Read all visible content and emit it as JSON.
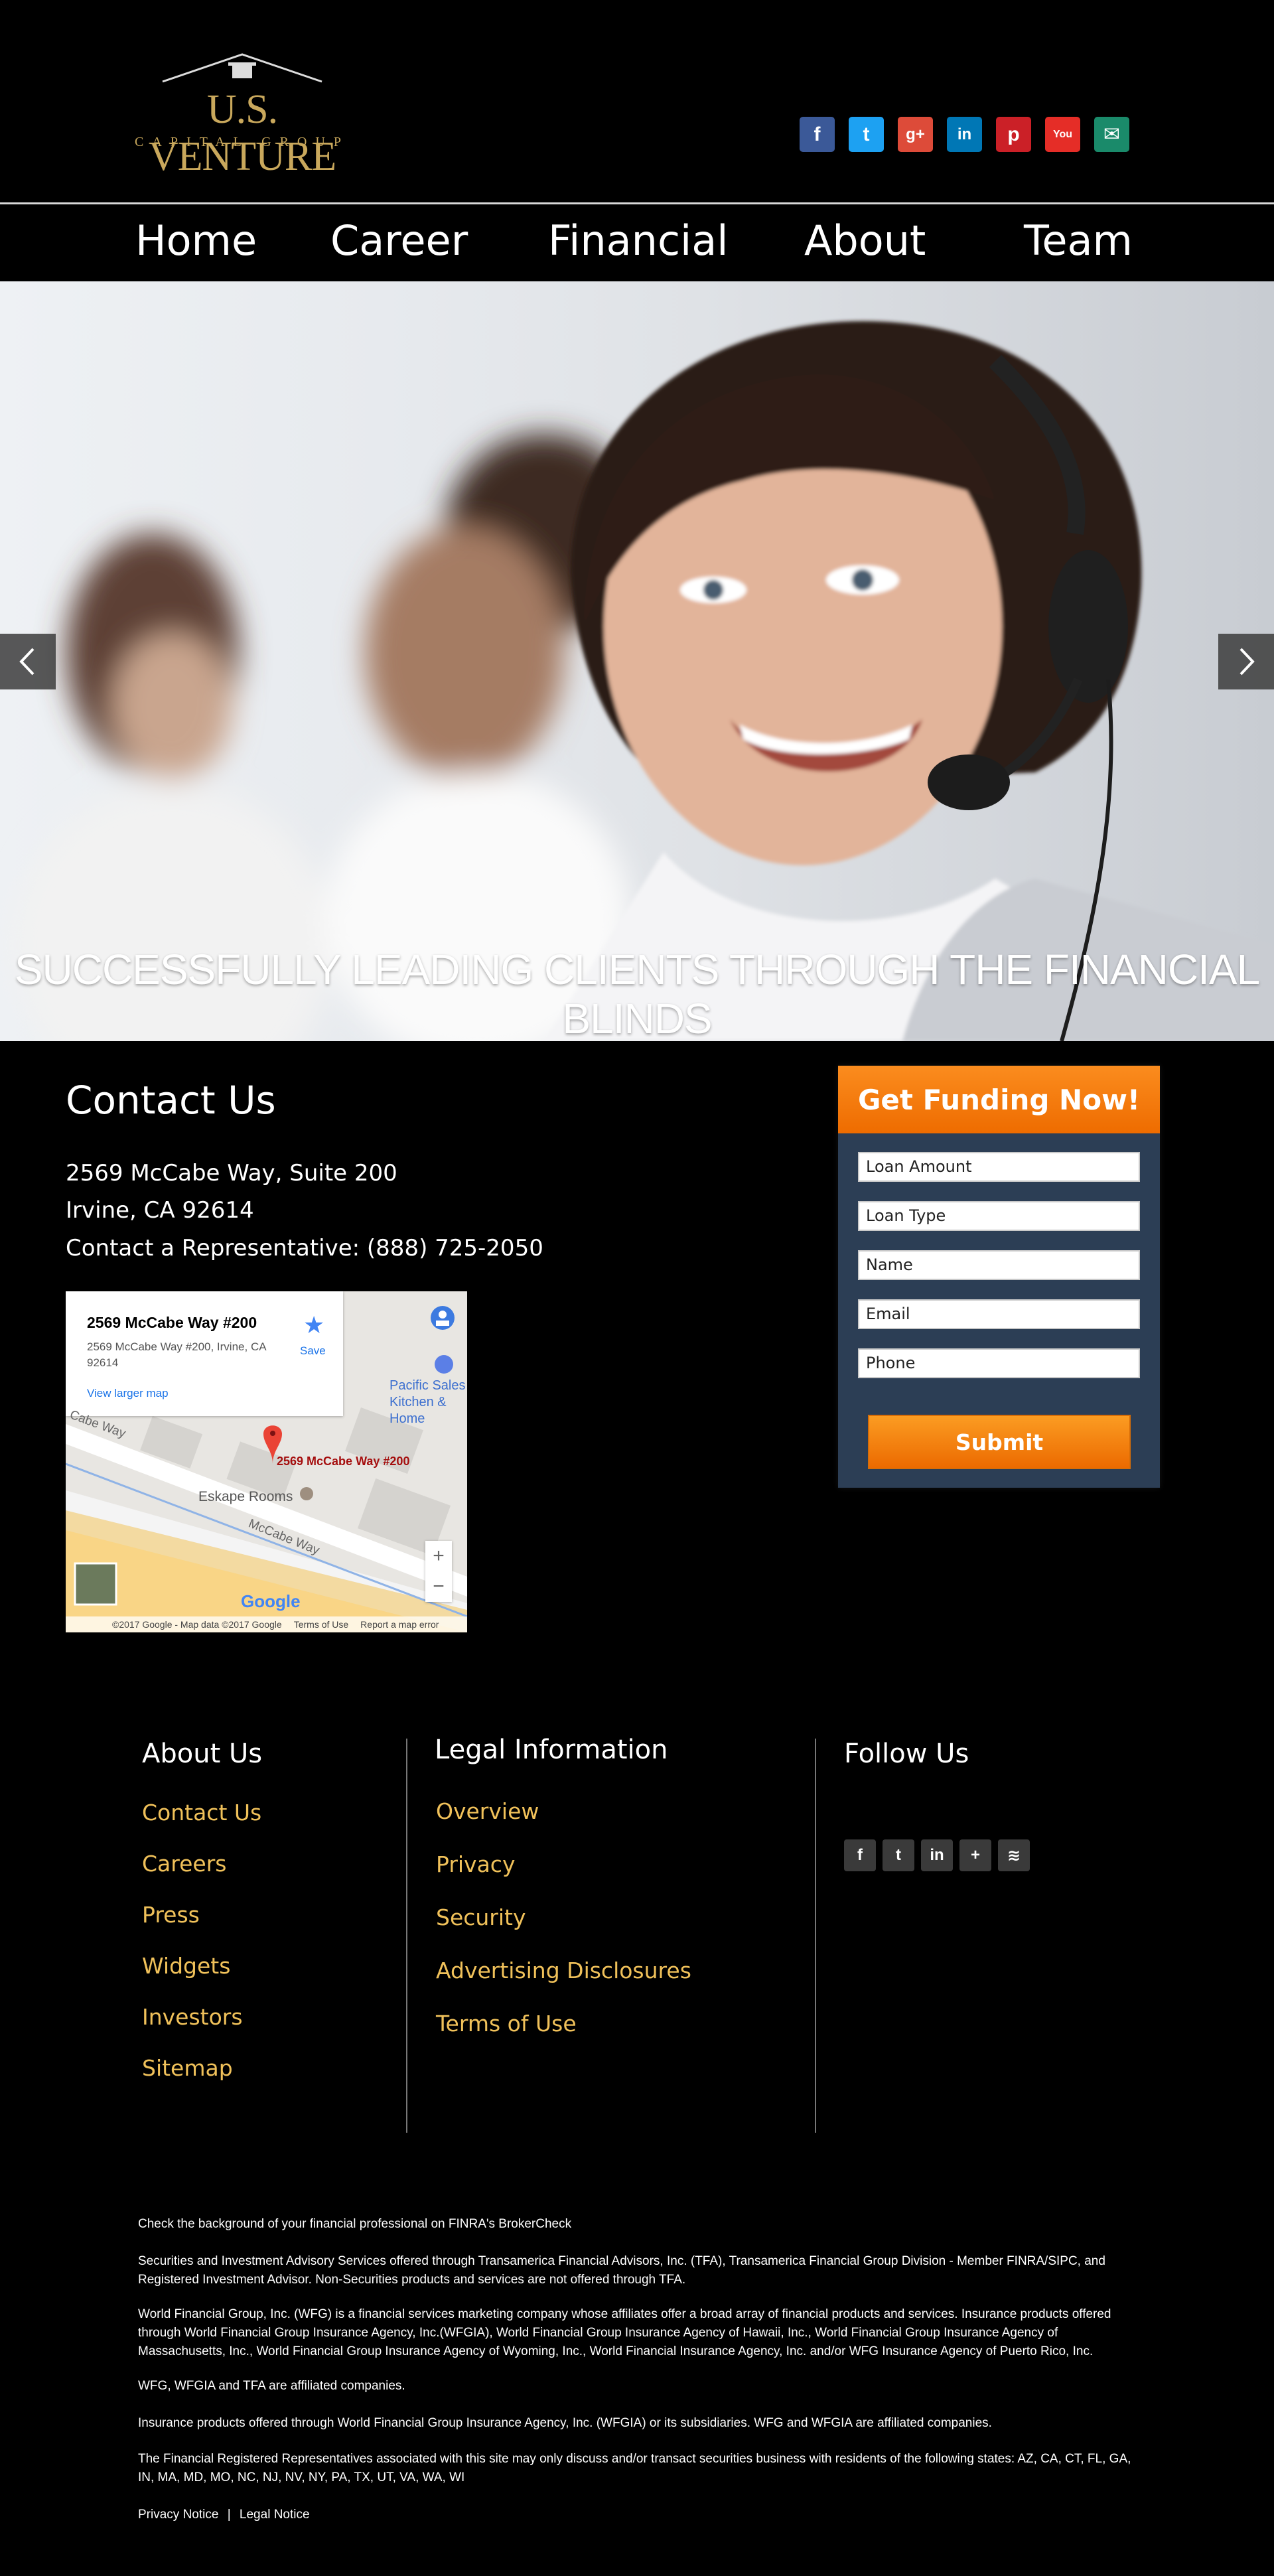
{
  "brand": {
    "name": "U.S. VENTURE",
    "sub": "CAPITAL GROUP",
    "gold": "#c9a85c"
  },
  "social_top": [
    {
      "name": "facebook-icon",
      "glyph": "f",
      "color": "#3b5998"
    },
    {
      "name": "twitter-icon",
      "glyph": "t",
      "color": "#1da1f2"
    },
    {
      "name": "google-plus-icon",
      "glyph": "g+",
      "color": "#dd4b39"
    },
    {
      "name": "linkedin-icon",
      "glyph": "in",
      "color": "#0077b5"
    },
    {
      "name": "pinterest-icon",
      "glyph": "p",
      "color": "#cb2027"
    },
    {
      "name": "youtube-icon",
      "glyph": "You",
      "color": "#e52d27"
    },
    {
      "name": "mail-icon",
      "glyph": "✉",
      "color": "#1a8a6a"
    }
  ],
  "nav": [
    "Home",
    "Career",
    "Financial",
    "About",
    "Team"
  ],
  "hero": {
    "caption": "SUCCESSFULLY LEADING CLIENTS THROUGH THE FINANCIAL BLINDS"
  },
  "contact": {
    "title": "Contact Us",
    "line1": "2569 McCabe Way, Suite 200",
    "line2": "Irvine, CA 92614",
    "line3": "Contact a Representative: (888) 725-2050"
  },
  "map": {
    "place_title": "2569 McCabe Way #200",
    "place_address": "2569 McCabe Way #200, Irvine, CA 92614",
    "view_larger": "View larger map",
    "save": "Save",
    "pin_label": "2569 McCabe Way #200",
    "eskape": "Eskape Rooms",
    "pacific": "Pacific Sales Kitchen & Home",
    "road1": "McCabe Way",
    "road2": "Cabe Way",
    "zoom_in": "+",
    "zoom_out": "−",
    "google": "Google",
    "attribution": "©2017 Google - Map data ©2017 Google",
    "terms": "Terms of Use",
    "report": "Report a map error"
  },
  "form": {
    "title": "Get Funding Now!",
    "fields": [
      "Loan Amount",
      "Loan Type",
      "Name",
      "Email",
      "Phone"
    ],
    "submit": "Submit",
    "accent": "#f7850f",
    "panel": "#2c3e55"
  },
  "footer": {
    "about_title": "About Us",
    "about_links": [
      "Contact Us",
      "Careers",
      "Press",
      "Widgets",
      "Investors",
      "Sitemap"
    ],
    "legal_title": "Legal Information",
    "legal_links": [
      "Overview",
      "Privacy",
      "Security",
      "Advertising Disclosures",
      "Terms of Use"
    ],
    "follow_title": "Follow Us",
    "follow_icons": [
      {
        "name": "facebook-icon",
        "glyph": "f"
      },
      {
        "name": "twitter-icon",
        "glyph": "t"
      },
      {
        "name": "linkedin-icon",
        "glyph": "in"
      },
      {
        "name": "plus-icon",
        "glyph": "+"
      },
      {
        "name": "rss-icon",
        "glyph": "≋"
      }
    ],
    "link_color": "#f0c15a"
  },
  "disclaimers": {
    "p1": "Check the background of your financial professional on FINRA's BrokerCheck",
    "p2": "Securities and Investment Advisory Services offered through Transamerica Financial Advisors, Inc. (TFA), Transamerica Financial Group Division - Member FINRA/SIPC, and Registered Investment Advisor. Non-Securities products and services are not offered through TFA.",
    "p3": "World Financial Group, Inc. (WFG) is a financial services marketing company whose affiliates offer a broad array of financial products and services. Insurance products offered through World Financial Group Insurance Agency, Inc.(WFGIA), World Financial Group Insurance Agency of Hawaii, Inc., World Financial Group Insurance Agency of Massachusetts, Inc., World Financial Group Insurance Agency of Wyoming, Inc., World Financial Insurance Agency, Inc. and/or WFG Insurance Agency of Puerto Rico, Inc.",
    "p4": "WFG, WFGIA and TFA are affiliated companies.",
    "p5": "Insurance products offered through World Financial Group Insurance Agency, Inc. (WFGIA) or its subsidiaries. WFG and WFGIA are affiliated companies.",
    "p6": "The Financial Registered Representatives associated with this site may only discuss and/or transact securities business with residents of the following states: AZ, CA, CT, FL, GA, IN, MA, MD, MO, NC, NJ, NV, NY, PA, TX, UT, VA, WA, WI",
    "privacy": "Privacy Notice",
    "sep": "|",
    "legal": "Legal Notice"
  }
}
